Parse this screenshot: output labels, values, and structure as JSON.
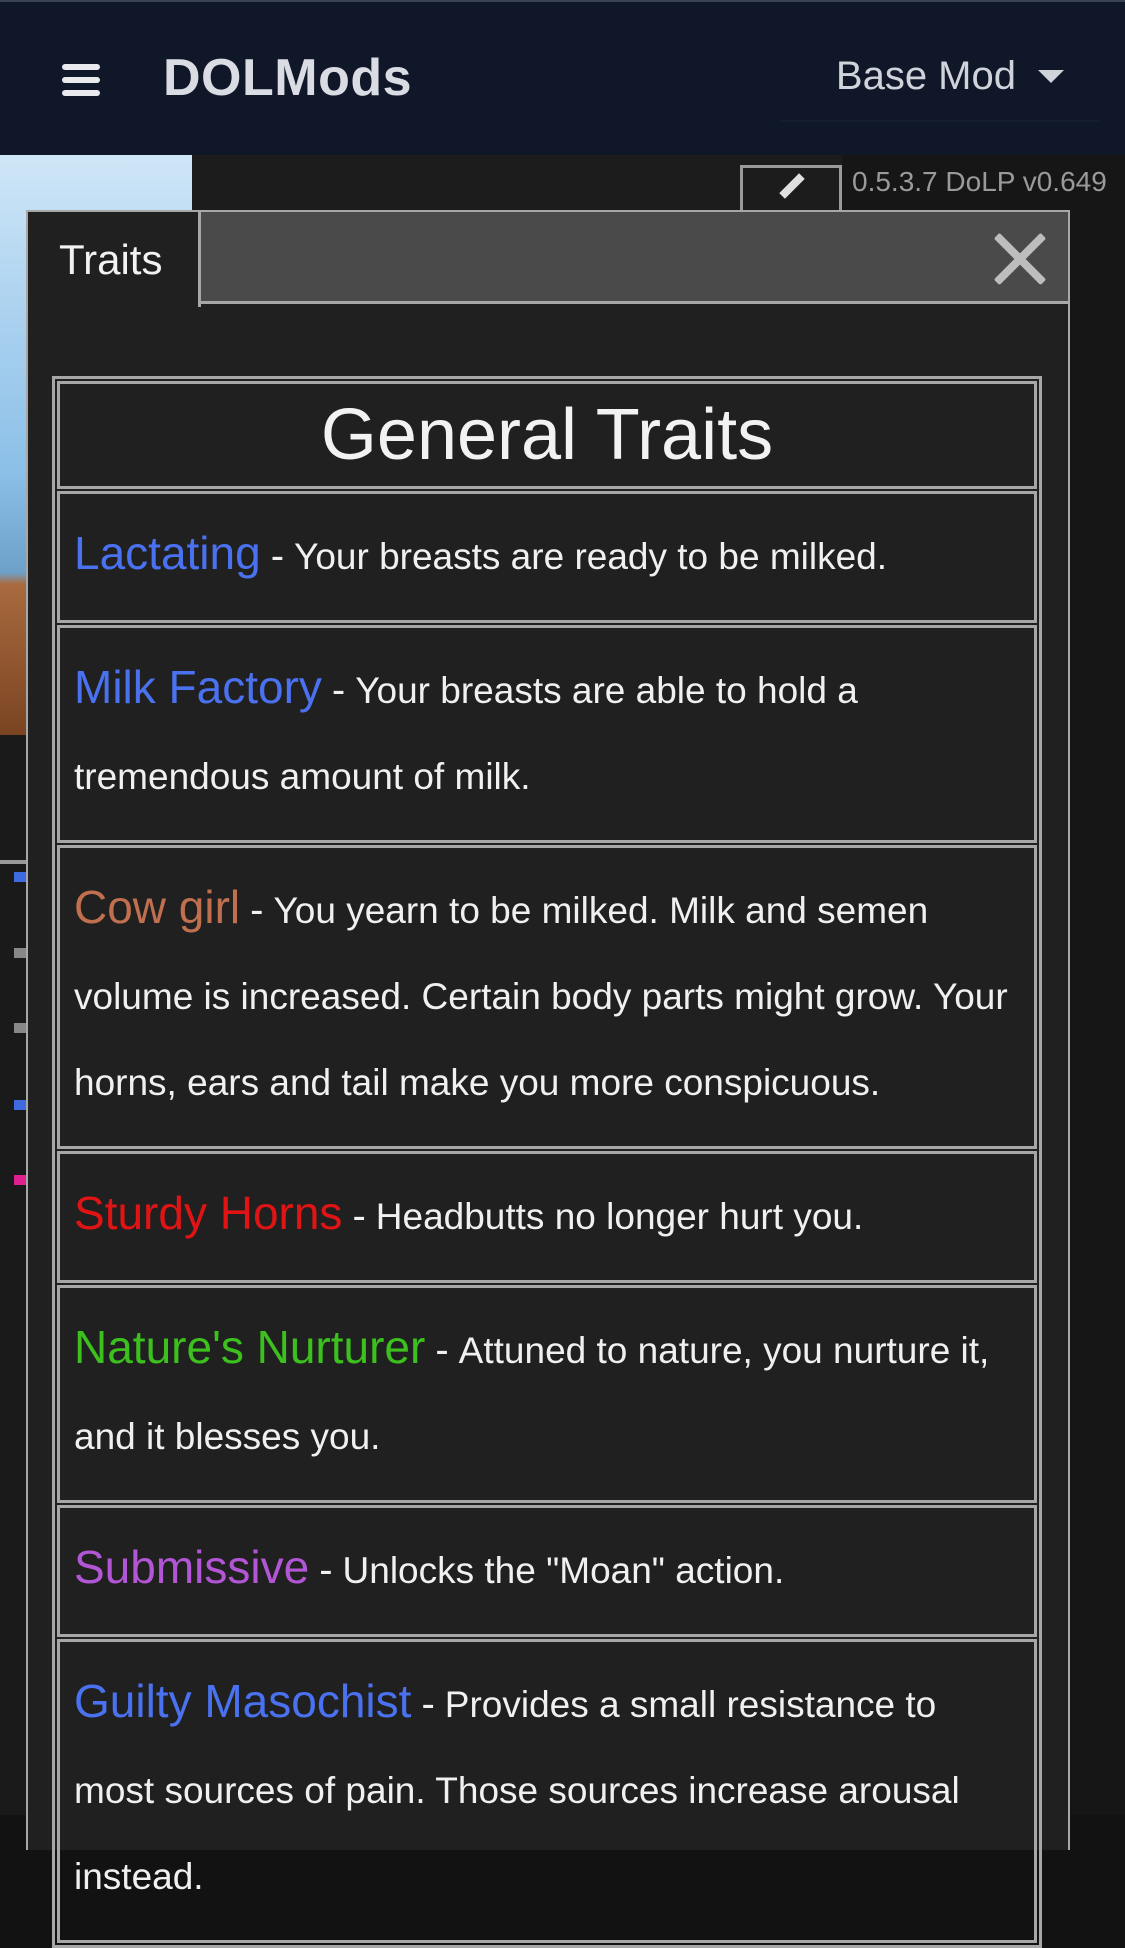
{
  "navbar": {
    "brand": "DOLMods",
    "mod_select": "Base Mod"
  },
  "game": {
    "version": "0.5.3.7 DoLP v0.649"
  },
  "modal": {
    "tab_label": "Traits",
    "section_title": "General Traits",
    "separator": "-",
    "traits": [
      {
        "name": "Lactating",
        "description": "Your breasts are ready to be milked.",
        "color": "#4a72f0"
      },
      {
        "name": "Milk Factory",
        "description": "Your breasts are able to hold a tremendous amount of milk.",
        "color": "#4a72f0"
      },
      {
        "name": "Cow girl",
        "description": "You yearn to be milked. Milk and semen volume is increased. Certain body parts might grow. Your horns, ears and tail make you more conspicuous.",
        "color": "#c0704f"
      },
      {
        "name": "Sturdy Horns",
        "description": "Headbutts no longer hurt you.",
        "color": "#e01414"
      },
      {
        "name": "Nature's Nurturer",
        "description": "Attuned to nature, you nurture it, and it blesses you.",
        "color": "#3cc01e"
      },
      {
        "name": "Submissive",
        "description": "Unlocks the \"Moan\" action.",
        "color": "#b256d6"
      },
      {
        "name": "Guilty Masochist",
        "description": "Provides a small resistance to most sources of pain. Those sources increase arousal instead.",
        "color": "#4a72f0"
      }
    ]
  }
}
